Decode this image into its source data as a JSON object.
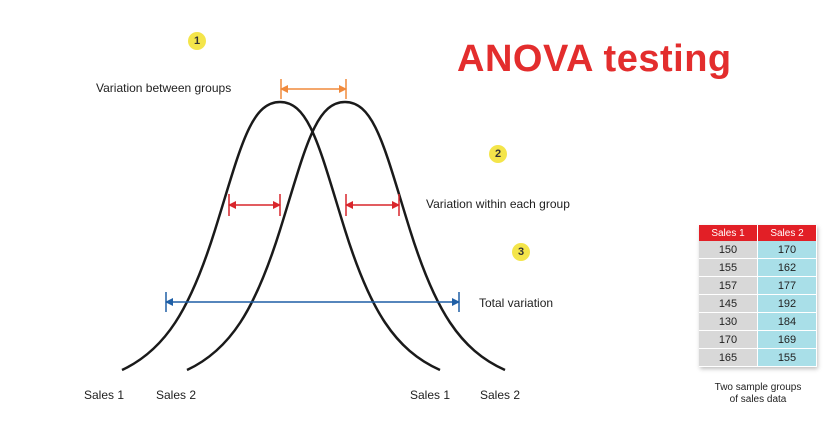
{
  "title": "ANOVA testing",
  "badges": [
    "1",
    "2",
    "3"
  ],
  "labels": {
    "between": "Variation between groups",
    "within": "Variation within each group",
    "total": "Total variation"
  },
  "curve_labels": {
    "left_sales1": "Sales 1",
    "left_sales2": "Sales 2",
    "right_sales1": "Sales 1",
    "right_sales2": "Sales 2"
  },
  "table": {
    "headers": [
      "Sales 1",
      "Sales 2"
    ],
    "rows": [
      [
        "150",
        "170"
      ],
      [
        "155",
        "162"
      ],
      [
        "157",
        "177"
      ],
      [
        "145",
        "192"
      ],
      [
        "130",
        "184"
      ],
      [
        "170",
        "169"
      ],
      [
        "165",
        "155"
      ]
    ],
    "caption_line1": "Two sample groups",
    "caption_line2": "of sales data"
  },
  "colors": {
    "title": "#e32d2d",
    "between_arrow": "#f08a3c",
    "within_arrow": "#d9262c",
    "total_arrow": "#1f5fa6",
    "badge": "#f4e54a",
    "table_header": "#e21f26",
    "col1": "#d8d8d8",
    "col2": "#a9dfe8"
  }
}
